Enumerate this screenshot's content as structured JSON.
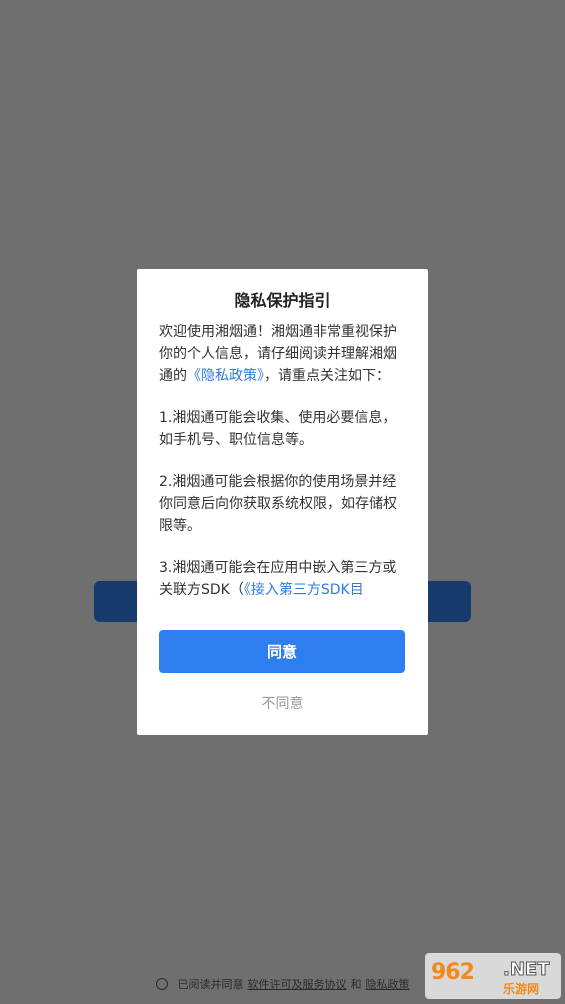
{
  "footer": {
    "prefix": "已阅读并同意",
    "license_link": "软件许可及服务协议",
    "and": "和",
    "privacy_link": "隐私政策"
  },
  "dialog": {
    "title": "隐私保护指引",
    "intro_before": "欢迎使用湘烟通！湘烟通非常重视保护你的个人信息，请仔细阅读并理解湘烟通的",
    "intro_link": "《隐私政策》",
    "intro_after": "，请重点关注如下：",
    "item1": "1.湘烟通可能会收集、使用必要信息，如手机号、职位信息等。",
    "item2": "2.湘烟通可能会根据你的使用场景并经你同意后向你获取系统权限，如存储权限等。",
    "item3_before": "3.湘烟通可能会在应用中嵌入第三方或关联方SDK（",
    "item3_link": "《接入第三方SDK目",
    "agree_label": "同意",
    "disagree_label": "不同意"
  },
  "watermark": {
    "logo_text": "962",
    "domain_text": ".NET",
    "site_name": "乐游网"
  },
  "colors": {
    "accent": "#2f7ef0",
    "link": "#2f7be0",
    "overlay": "#6f6f6f"
  }
}
